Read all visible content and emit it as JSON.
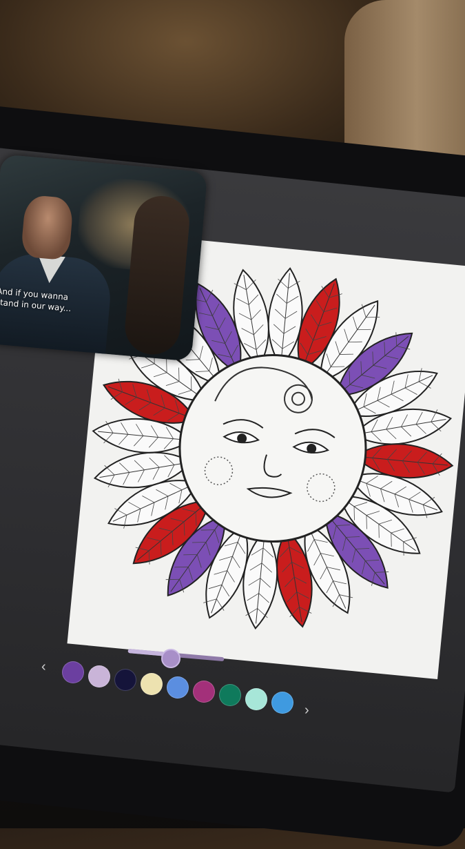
{
  "video": {
    "subtitle_line1": "And if you wanna",
    "subtitle_line2": "stand in our way..."
  },
  "coloring": {
    "brush_size": 0.45,
    "palette": [
      {
        "name": "purple",
        "hex": "#6b3fa0"
      },
      {
        "name": "lavender",
        "hex": "#c9b4d8"
      },
      {
        "name": "navy",
        "hex": "#15143a"
      },
      {
        "name": "cream",
        "hex": "#ede2b0"
      },
      {
        "name": "sky-blue",
        "hex": "#5b8ee0"
      },
      {
        "name": "magenta",
        "hex": "#a3307a"
      },
      {
        "name": "teal",
        "hex": "#0f7a5c"
      },
      {
        "name": "mint",
        "hex": "#a7e6d8"
      },
      {
        "name": "blue",
        "hex": "#3f9ae0"
      }
    ],
    "prev_label": "‹",
    "next_label": "›"
  }
}
